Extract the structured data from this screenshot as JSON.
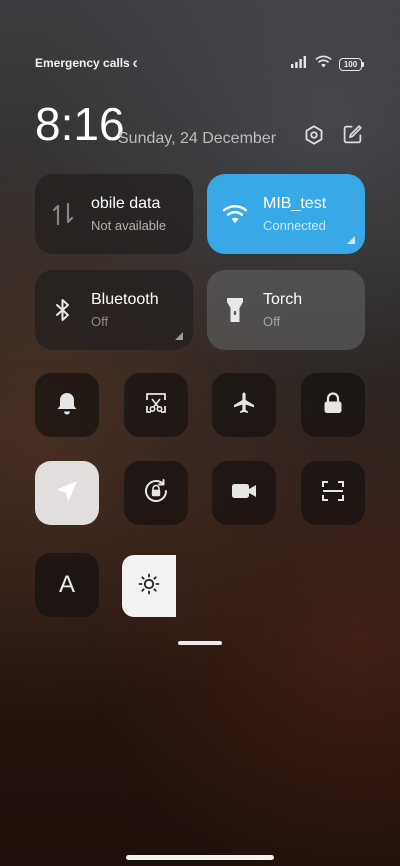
{
  "status_bar": {
    "carrier_text": "Emergency calls o",
    "battery_level": "100",
    "icons": [
      "signal-icon",
      "wifi-icon",
      "battery-icon"
    ]
  },
  "header": {
    "time": "8:16",
    "date": "Sunday, 24 December",
    "icons": [
      "settings-icon",
      "edit-icon"
    ]
  },
  "tiles": {
    "mobile_data": {
      "name": "obile data",
      "status": "Not available",
      "icon": "data-arrows-icon"
    },
    "wifi": {
      "name": "MIB_test",
      "status": "Connected",
      "icon": "wifi-icon",
      "color": "#39a8e6"
    },
    "bluetooth": {
      "name": "Bluetooth",
      "status": "Off",
      "icon": "bluetooth-icon"
    },
    "torch": {
      "name": "Torch",
      "status": "Off",
      "icon": "flashlight-icon"
    }
  },
  "toggles": {
    "row1": [
      "bell-icon",
      "screenshot-icon",
      "airplane-icon",
      "lock-icon"
    ],
    "row2": [
      "location-icon",
      "rotation-lock-icon",
      "video-icon",
      "scan-icon"
    ],
    "row3": [
      "font-icon",
      "brightness-icon"
    ],
    "font_glyph": "A",
    "location_active": true
  }
}
